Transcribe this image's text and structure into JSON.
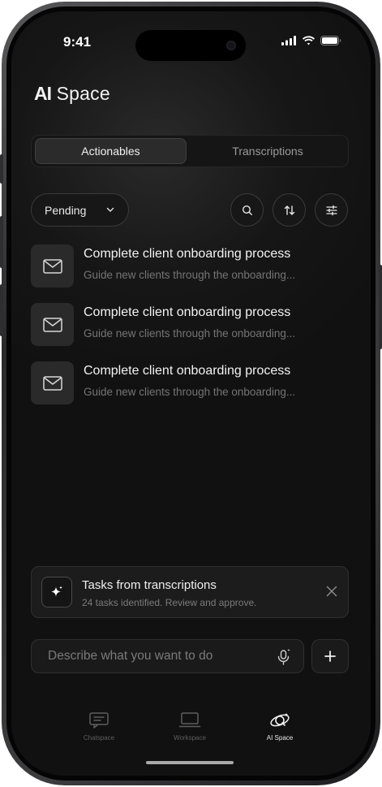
{
  "status_bar": {
    "time": "9:41"
  },
  "app": {
    "title_strong": "AI",
    "title_rest": " Space"
  },
  "tabs": [
    {
      "label": "Actionables",
      "active": true
    },
    {
      "label": "Transcriptions",
      "active": false
    }
  ],
  "filter": {
    "selected": "Pending",
    "icons": [
      "search-icon",
      "sort-icon",
      "filter-sliders-icon"
    ]
  },
  "actionables": [
    {
      "icon": "mail-icon",
      "title": "Complete client onboarding process",
      "description": "Guide new clients through the onboarding..."
    },
    {
      "icon": "mail-icon",
      "title": "Complete client onboarding process",
      "description": "Guide new clients through the onboarding..."
    },
    {
      "icon": "mail-icon",
      "title": "Complete client onboarding process",
      "description": "Guide new clients through the onboarding..."
    }
  ],
  "banner": {
    "icon": "sparkle-icon",
    "title": "Tasks from transcriptions",
    "subtitle": "24 tasks identified. Review and approve."
  },
  "composer": {
    "placeholder": "Describe what you want to do",
    "mic_icon": "mic-sparkle-icon",
    "add_icon": "plus-icon"
  },
  "bottom_nav": [
    {
      "label": "Chatspace",
      "icon": "chat-icon",
      "active": false
    },
    {
      "label": "Workspace",
      "icon": "laptop-icon",
      "active": false
    },
    {
      "label": "AI Space",
      "icon": "ai-space-icon",
      "active": true
    }
  ],
  "colors": {
    "background": "#111111",
    "surface": "#1c1c1c",
    "text": "#f3f3f3",
    "muted": "#757575"
  }
}
